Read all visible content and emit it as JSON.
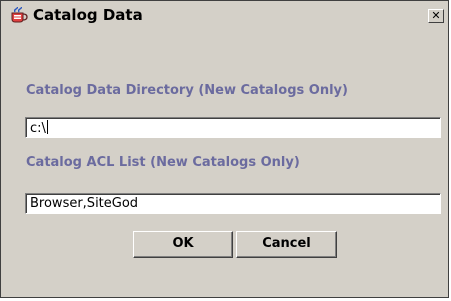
{
  "window": {
    "title": "Catalog Data",
    "close_symbol": "✕",
    "icon": "java-cup-icon"
  },
  "form": {
    "directory_label": "Catalog Data Directory (New Catalogs Only)",
    "directory_value": "c:\\",
    "acl_label": "Catalog ACL List (New Catalogs Only)",
    "acl_value": "Browser,SiteGod"
  },
  "buttons": {
    "ok": "OK",
    "cancel": "Cancel"
  }
}
